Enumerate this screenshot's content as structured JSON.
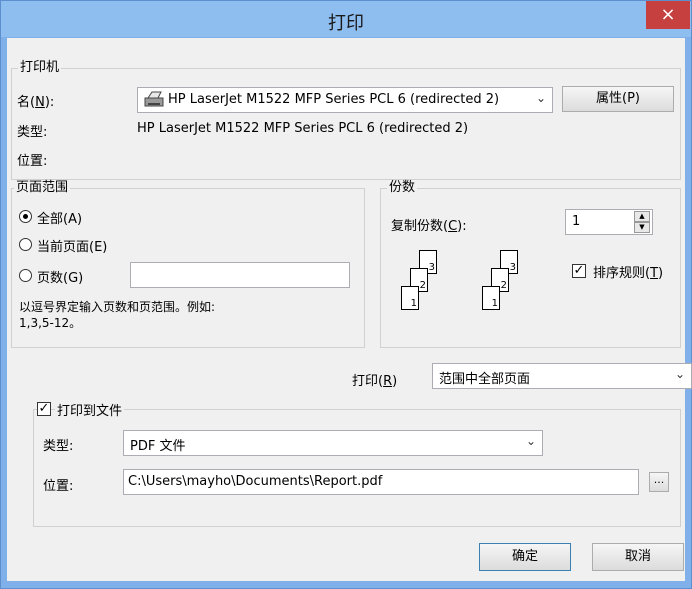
{
  "window": {
    "title": "打印",
    "close": "×"
  },
  "printer": {
    "legend": "打印机",
    "name_label": "名(",
    "name_key": "N",
    "name_label_end": "):",
    "name_value": "HP LaserJet M1522 MFP Series PCL 6 (redirected 2)",
    "properties_label": "属性(P)",
    "type_label": "类型:",
    "type_value": "HP LaserJet M1522 MFP Series PCL 6 (redirected 2)",
    "location_label": "位置:"
  },
  "page_range": {
    "legend": "页面范围",
    "all_label": "全部(A)",
    "current_label": "当前页面(E)",
    "pages_label": "页数(G)",
    "pages_value": "",
    "hint": "以逗号界定输入页数和页范围。例如:",
    "hint_example": "1,3,5-12。"
  },
  "copies": {
    "legend": "份数",
    "count_label": "复制份数(",
    "count_key": "C",
    "count_label_end": "):",
    "count_value": "1",
    "collate_label": "排序规则(",
    "collate_key": "T",
    "collate_label_end": ")",
    "collate_checked": true,
    "page_numbers": [
      "1",
      "2",
      "3"
    ]
  },
  "print_what": {
    "label": "打印(",
    "key": "R",
    "label_end": ")",
    "value": "范围中全部页面"
  },
  "print_to_file": {
    "legend": "打印到文件",
    "checked": true,
    "type_label": "类型:",
    "type_value": "PDF 文件",
    "location_label": "位置:",
    "location_value": "C:\\Users\\mayho\\Documents\\Report.pdf",
    "browse_label": "..."
  },
  "buttons": {
    "ok": "确定",
    "cancel": "取消"
  }
}
